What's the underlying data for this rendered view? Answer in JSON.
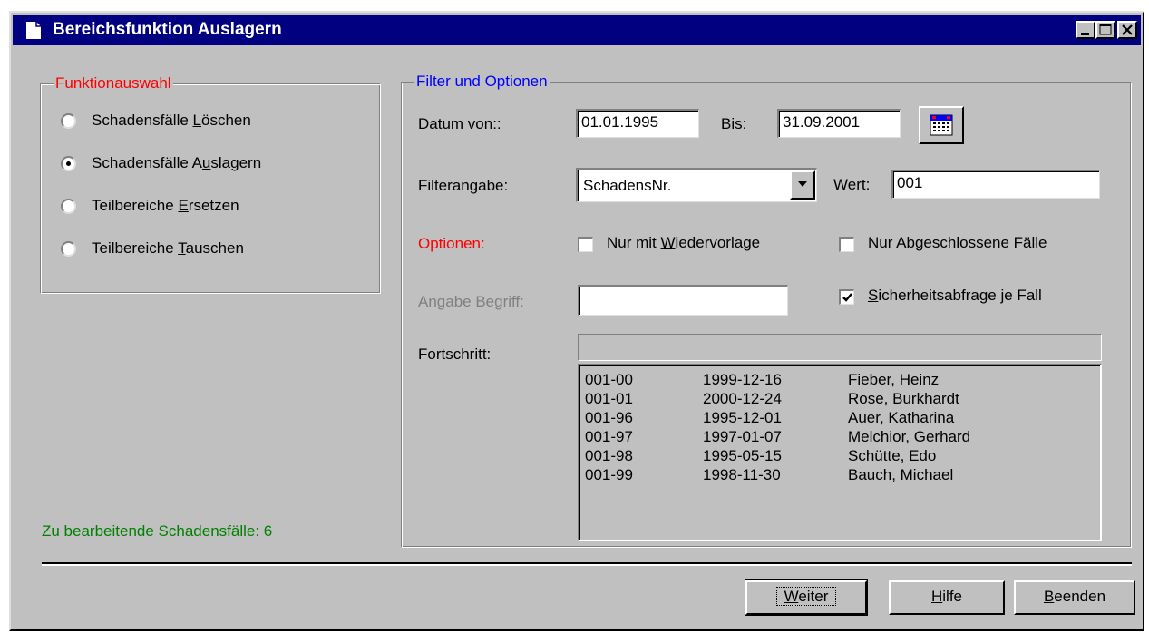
{
  "window": {
    "title": "Bereichsfunktion Auslagern"
  },
  "funktionsauswahl": {
    "legend": "Funktionauswahl",
    "options": [
      {
        "pre": "Schadensfälle ",
        "key": "L",
        "post": "öschen",
        "selected": false
      },
      {
        "pre": "Schadensfälle A",
        "key": "u",
        "post": "slagern",
        "selected": true
      },
      {
        "pre": "Teilbereiche ",
        "key": "E",
        "post": "rsetzen",
        "selected": false
      },
      {
        "pre": "Teilbereiche ",
        "key": "T",
        "post": "auschen",
        "selected": false
      }
    ]
  },
  "status": {
    "text": "Zu bearbeitende Schadensfälle: 6"
  },
  "filter": {
    "legend": "Filter und Optionen",
    "datum_label": "Datum von::",
    "datum_von": "01.01.1995",
    "bis_label": "Bis:",
    "datum_bis": "31.09.2001",
    "filterangabe_label": "Filterangabe:",
    "filterangabe_value": "SchadensNr.",
    "wert_label": "Wert:",
    "wert_value": "001",
    "optionen_label": "Optionen:",
    "wiedervorlage": {
      "pre": "Nur mit ",
      "key": "W",
      "post": "iedervorlage",
      "checked": false
    },
    "abgeschlossen": {
      "label": "Nur Abgeschlossene Fälle",
      "checked": false
    },
    "angabe_label": "Angabe Begriff:",
    "angabe_value": "",
    "sicherheit": {
      "pre": "",
      "key": "S",
      "post": "icherheitsabfrage je Fall",
      "checked": true
    },
    "fortschritt_label": "Fortschritt:",
    "progress": 0
  },
  "results": [
    {
      "nr": "001-00",
      "datum": "1999-12-16",
      "name": "Fieber, Heinz"
    },
    {
      "nr": "001-01",
      "datum": "2000-12-24",
      "name": "Rose, Burkhardt"
    },
    {
      "nr": "001-96",
      "datum": "1995-12-01",
      "name": "Auer, Katharina"
    },
    {
      "nr": "001-97",
      "datum": "1997-01-07",
      "name": "Melchior, Gerhard"
    },
    {
      "nr": "001-98",
      "datum": "1995-05-15",
      "name": "Schütte, Edo"
    },
    {
      "nr": "001-99",
      "datum": "1998-11-30",
      "name": "Bauch, Michael"
    }
  ],
  "buttons": {
    "weiter": {
      "pre": "",
      "key": "W",
      "post": "eiter"
    },
    "hilfe": {
      "pre": "",
      "key": "H",
      "post": "ilfe"
    },
    "beenden": {
      "pre": "",
      "key": "B",
      "post": "eenden"
    }
  },
  "colors": {
    "titlebar": "#000080",
    "legend_red": "#ff0000",
    "legend_blue": "#0000ff",
    "status_green": "#008000",
    "disabled_gray": "#808080"
  },
  "icons": {
    "title": "document-icon",
    "calendar": "calendar-icon",
    "dropdown": "chevron-down-icon"
  }
}
